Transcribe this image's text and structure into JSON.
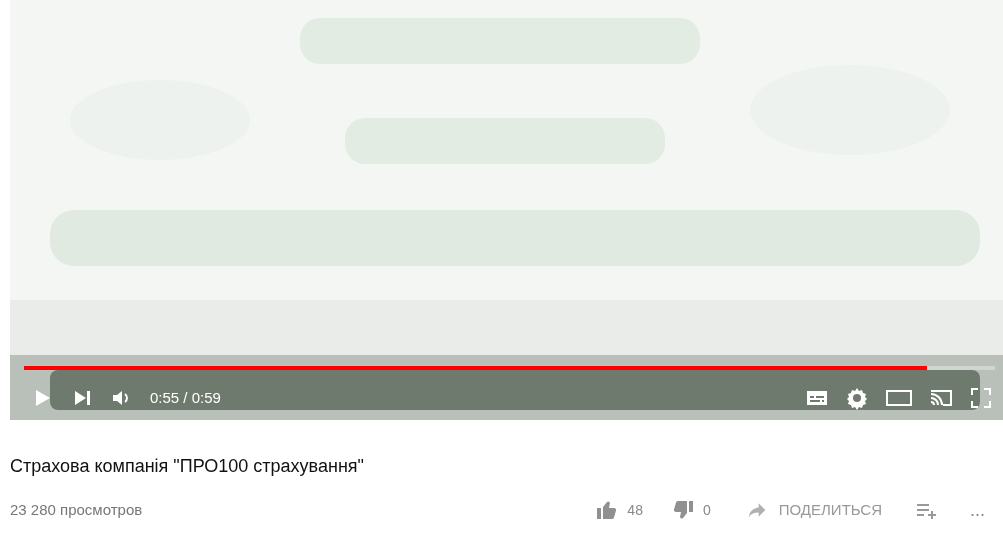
{
  "player": {
    "kind": "picture",
    "progress": {
      "level": 0.93
    },
    "time": "0:55 / 0:59"
  },
  "video": {
    "title": "Страхова компанія \"ПРО100 страхування\"",
    "views": "23 280 просмотров",
    "likes": "48",
    "dislikes": "0",
    "share": "ПОДЕЛИТЬСЯ",
    "more": "..."
  }
}
